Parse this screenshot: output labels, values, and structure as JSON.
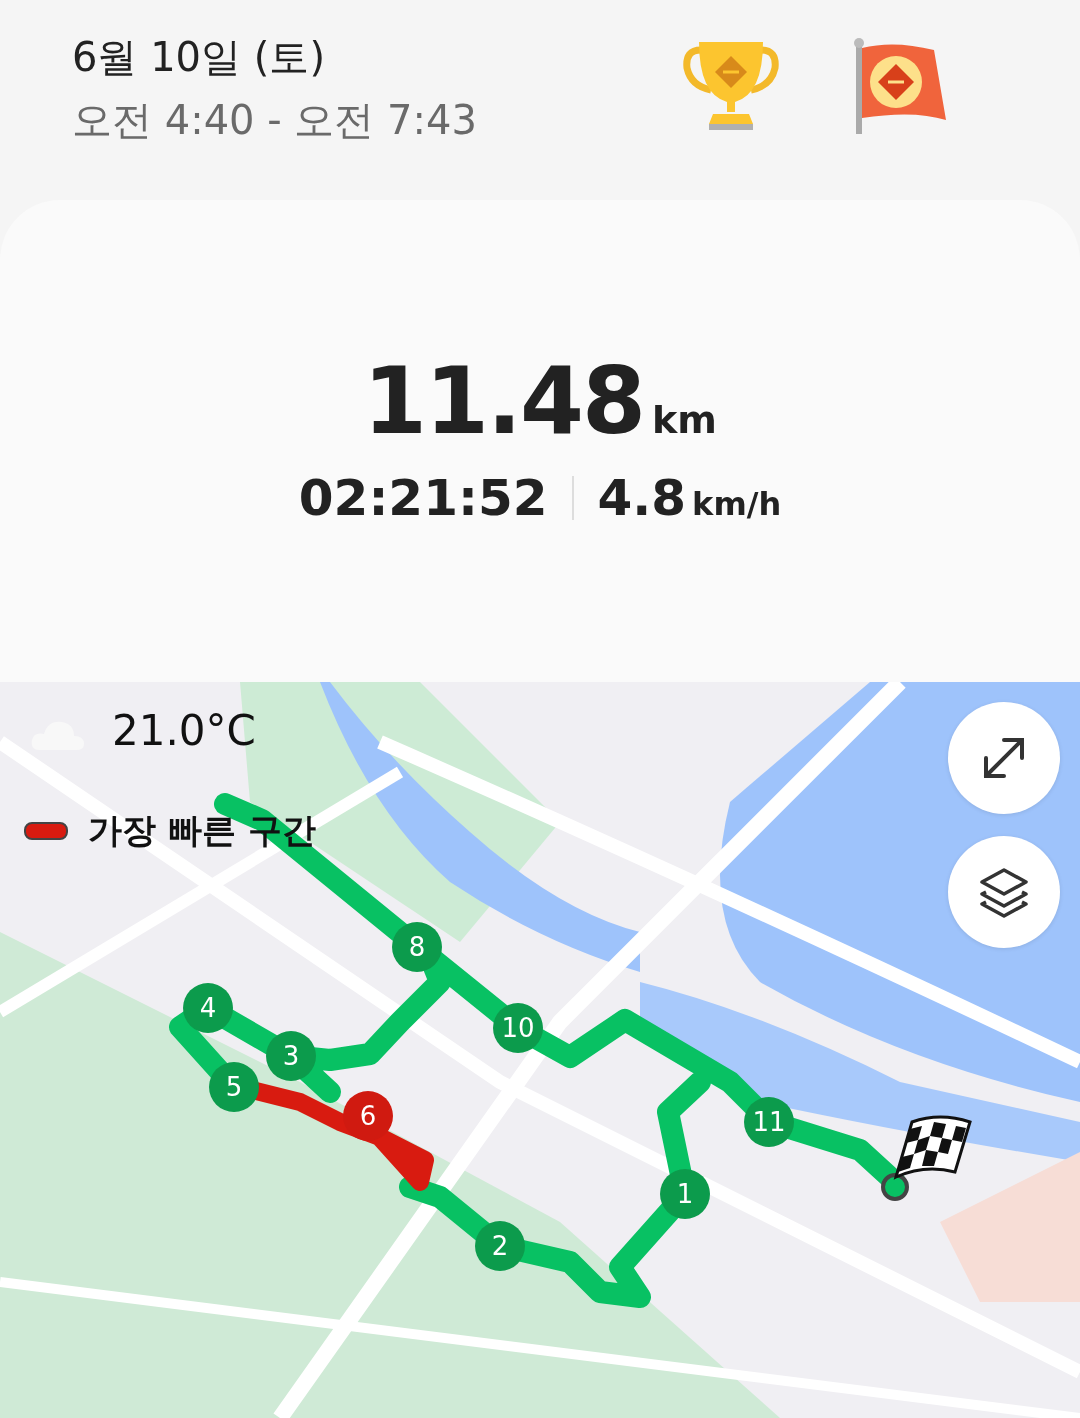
{
  "header": {
    "date": "6월 10일 (토)",
    "time_range": "오전 4:40 - 오전 7:43"
  },
  "summary": {
    "distance": "11.48",
    "distance_unit": "km",
    "duration": "02:21:52",
    "speed": "4.8",
    "speed_unit": "km/h"
  },
  "map": {
    "temperature": "21.0°C",
    "legend": "가장 빠른 구간",
    "markers": [
      {
        "label": "1",
        "fastest": false
      },
      {
        "label": "2",
        "fastest": false
      },
      {
        "label": "3",
        "fastest": false
      },
      {
        "label": "4",
        "fastest": false
      },
      {
        "label": "5",
        "fastest": false
      },
      {
        "label": "6",
        "fastest": true
      },
      {
        "label": "8",
        "fastest": false
      },
      {
        "label": "10",
        "fastest": false
      },
      {
        "label": "11",
        "fastest": false
      }
    ]
  }
}
